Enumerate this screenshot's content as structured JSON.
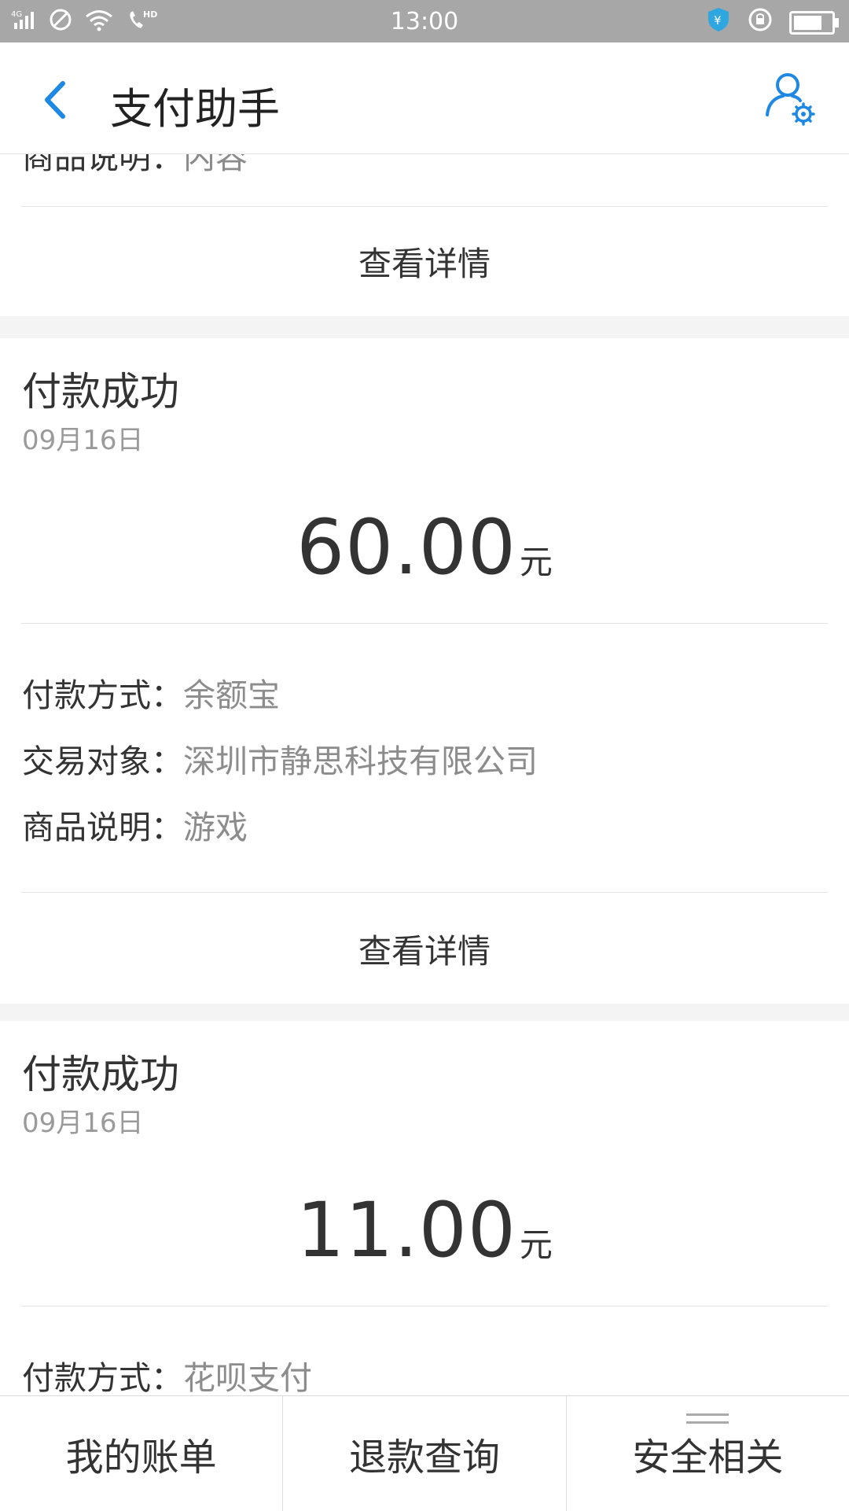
{
  "status_bar": {
    "time": "13:00",
    "network": "4G",
    "hd": "HD",
    "battery_level": 0.75
  },
  "header": {
    "title": "支付助手"
  },
  "cards": [
    {
      "partial_row": {
        "label": "商品说明：",
        "value": "内容"
      },
      "detail_link": "查看详情"
    },
    {
      "title": "付款成功",
      "date": "09月16日",
      "amount": "60.00",
      "unit": "元",
      "rows": [
        {
          "label": "付款方式：",
          "value": "余额宝"
        },
        {
          "label": "交易对象：",
          "value": "深圳市静思科技有限公司"
        },
        {
          "label": "商品说明：",
          "value": "游戏"
        }
      ],
      "detail_link": "查看详情"
    },
    {
      "title": "付款成功",
      "date": "09月16日",
      "amount": "11.00",
      "unit": "元",
      "rows": [
        {
          "label": "付款方式：",
          "value": "花呗支付"
        }
      ]
    }
  ],
  "tabs": [
    {
      "label": "我的账单"
    },
    {
      "label": "退款查询"
    },
    {
      "label": "安全相关"
    }
  ],
  "colors": {
    "accent": "#1e88e5",
    "status_bar": "#a7a7a7"
  }
}
